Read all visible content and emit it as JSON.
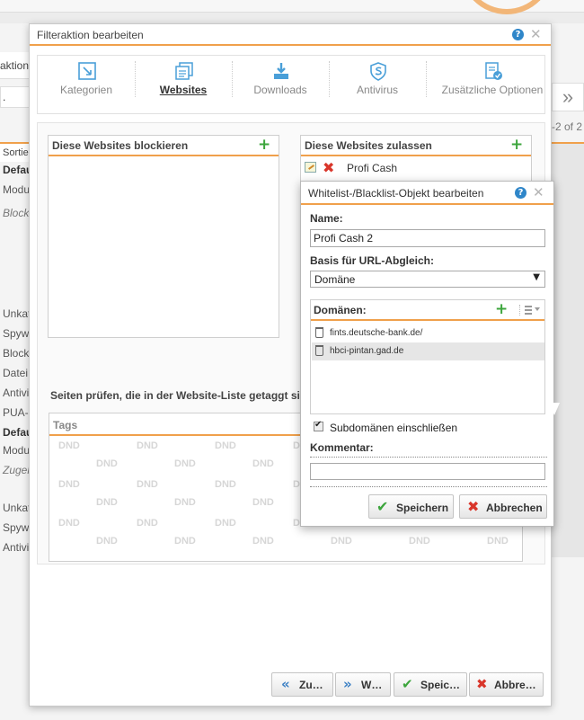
{
  "background": {
    "aktion_label": "aktion",
    "dot": ".",
    "nav_right": "»",
    "range_text": "-2 of 2",
    "table_header": "Sortier",
    "left_column": [
      {
        "text": "Defau",
        "style": "b"
      },
      {
        "text": "Modu",
        "style": ""
      },
      {
        "text": "Block",
        "style": "i"
      },
      {
        "text": "Unkat",
        "style": ""
      },
      {
        "text": "Spyw",
        "style": ""
      },
      {
        "text": "Block",
        "style": ""
      },
      {
        "text": "Datei",
        "style": ""
      },
      {
        "text": "Antivi",
        "style": ""
      },
      {
        "text": "PUA-",
        "style": ""
      },
      {
        "text": "Defaul",
        "style": "b"
      },
      {
        "text": "Modus",
        "style": ""
      },
      {
        "text": "Zugela",
        "style": "i"
      },
      {
        "text": "Unkate",
        "style": ""
      },
      {
        "text": "Spywa",
        "style": ""
      },
      {
        "text": "Antivir",
        "style": ""
      }
    ]
  },
  "dialog": {
    "title": "Filteraktion bearbeiten",
    "help": "?",
    "close": "✕",
    "tabs": [
      {
        "label": "Kategorien",
        "icon": "categories-icon",
        "active": false
      },
      {
        "label": "Websites",
        "icon": "websites-icon",
        "active": true
      },
      {
        "label": "Downloads",
        "icon": "downloads-icon",
        "active": false
      },
      {
        "label": "Antivirus",
        "icon": "antivirus-icon",
        "active": false
      },
      {
        "label": "Zusätzliche Optionen",
        "icon": "options-icon",
        "active": false
      }
    ],
    "block_list": {
      "header": "Diese Websites blockieren",
      "items": []
    },
    "allow_list": {
      "header": "Diese Websites zulassen",
      "items": [
        "Profi Cash"
      ]
    },
    "tag_check_label": "Seiten prüfen, die in der Website-Liste getaggt sind",
    "tags_header": "Tags",
    "dnd_label": "DND",
    "footer": {
      "back_label": "Zu…",
      "next_label": "W…",
      "save_label": "Speic…",
      "cancel_label": "Abbre…"
    },
    "plus": "+"
  },
  "subdialog": {
    "title": "Whitelist-/Blacklist-Objekt bearbeiten",
    "name_label": "Name:",
    "name_value": "Profi Cash 2",
    "basis_label": "Basis für URL-Abgleich:",
    "basis_value": "Domäne",
    "domains_label": "Domänen:",
    "domains": [
      {
        "text": "fints.deutsche-bank.de/",
        "selected": false
      },
      {
        "text": "hbci-pintan.gad.de",
        "selected": true
      }
    ],
    "subdomains_label": "Subdomänen einschließen",
    "subdomains_checked": true,
    "comment_label": "Kommentar:",
    "comment_value": "",
    "save_label": "Speichern",
    "cancel_label": "Abbrechen"
  },
  "colors": {
    "accent": "#f0a04b",
    "add": "#3ca53c",
    "remove": "#d9362b",
    "help": "#2f86c9"
  }
}
